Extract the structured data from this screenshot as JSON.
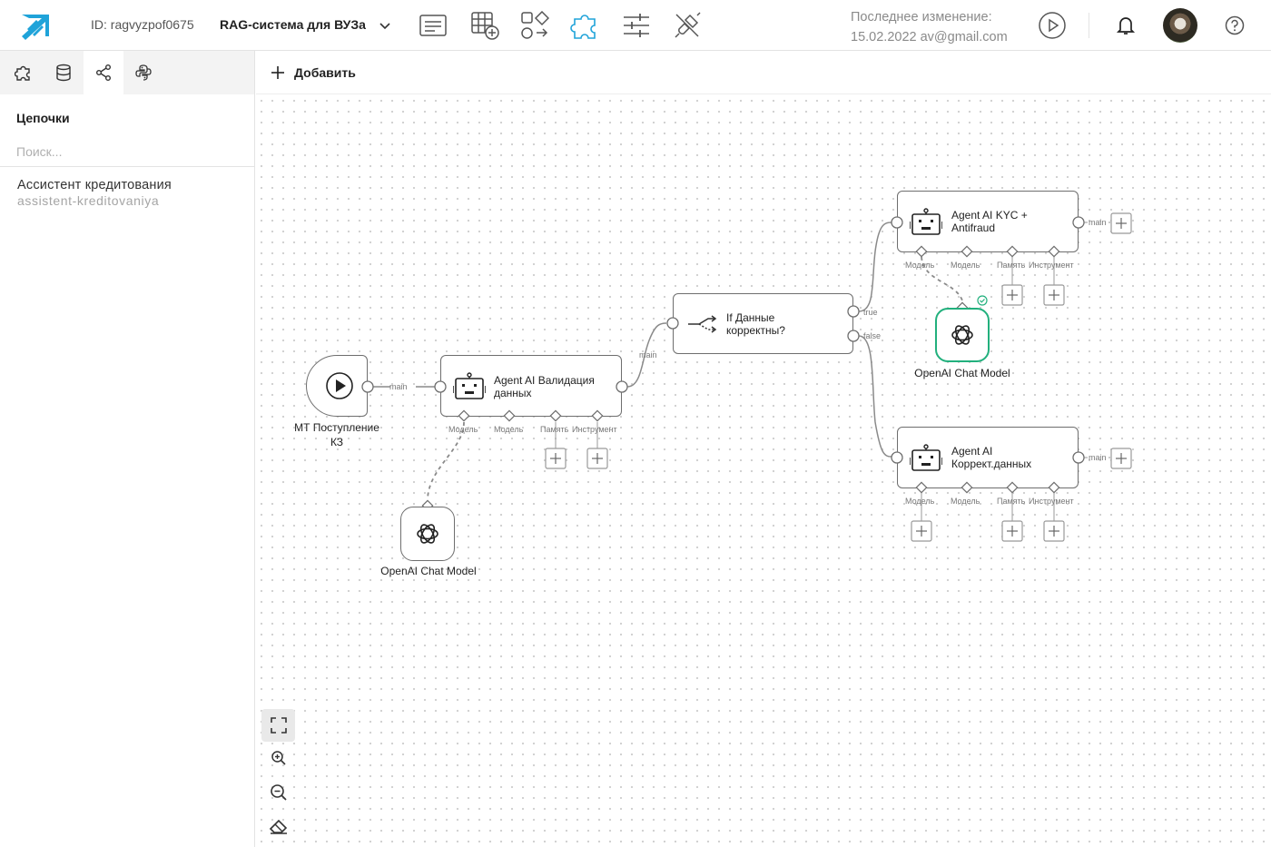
{
  "header": {
    "project_id": "ID: ragvyzpof0675",
    "project_name": "RAG-система для ВУЗа",
    "last_change_label": "Последнее изменение:",
    "last_change_value": "15.02.2022 av@gmail.com",
    "accent": "#1fa3d9"
  },
  "sidebar": {
    "section_title": "Цепочки",
    "search_placeholder": "Поиск...",
    "items": [
      {
        "name": "Ассистент кредитования",
        "slug": "assistent-kreditovaniya"
      }
    ]
  },
  "toolbar": {
    "add_label": "Добавить"
  },
  "nodes": {
    "trigger": {
      "caption_line1": "МТ Поступление",
      "caption_line2": "КЗ"
    },
    "agent_validation": {
      "title_line1": "Agent AI Валидация",
      "title_line2": "данных"
    },
    "if_node": {
      "title_line1": "If Данные",
      "title_line2": "корректны?"
    },
    "agent_kyc": {
      "title_line1": "Agent AI KYC +",
      "title_line2": "Antifraud"
    },
    "agent_correct": {
      "title_line1": "Agent AI",
      "title_line2": "Коррект.данных"
    },
    "openai_1": {
      "caption": "OpenAI Chat Model"
    },
    "openai_2": {
      "caption": "OpenAI Chat Model"
    }
  },
  "labels": {
    "main": "main",
    "true": "true",
    "false": "false",
    "model": "Модель",
    "memory": "Память",
    "tool": "Инструмент"
  },
  "colors": {
    "success": "#22b07d",
    "node_border": "#6e6e6e",
    "edge": "#8a8a8a"
  }
}
